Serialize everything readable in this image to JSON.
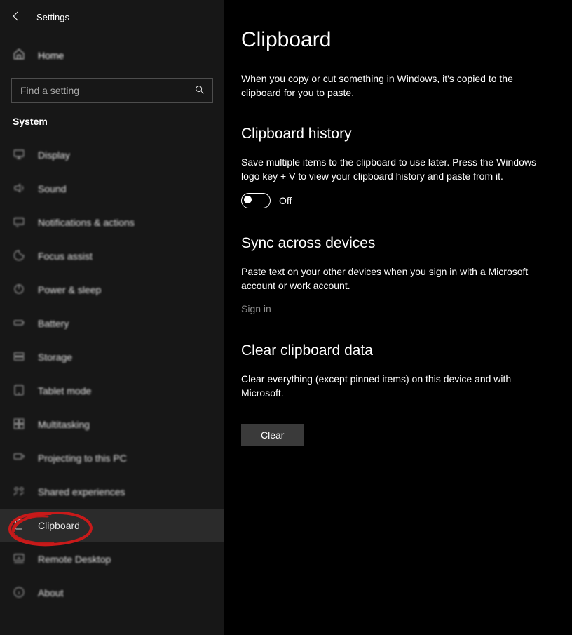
{
  "header": {
    "app": "Settings"
  },
  "sidebar": {
    "home": "Home",
    "search_placeholder": "Find a setting",
    "section": "System",
    "items": [
      {
        "label": "Display",
        "icon": "display-icon"
      },
      {
        "label": "Sound",
        "icon": "sound-icon"
      },
      {
        "label": "Notifications & actions",
        "icon": "notifications-icon"
      },
      {
        "label": "Focus assist",
        "icon": "focus-icon"
      },
      {
        "label": "Power & sleep",
        "icon": "power-icon"
      },
      {
        "label": "Battery",
        "icon": "battery-icon"
      },
      {
        "label": "Storage",
        "icon": "storage-icon"
      },
      {
        "label": "Tablet mode",
        "icon": "tablet-icon"
      },
      {
        "label": "Multitasking",
        "icon": "multitasking-icon"
      },
      {
        "label": "Projecting to this PC",
        "icon": "project-icon"
      },
      {
        "label": "Shared experiences",
        "icon": "shared-icon"
      },
      {
        "label": "Clipboard",
        "icon": "clipboard-icon",
        "active": true
      },
      {
        "label": "Remote Desktop",
        "icon": "remote-icon"
      },
      {
        "label": "About",
        "icon": "about-icon"
      }
    ]
  },
  "main": {
    "title": "Clipboard",
    "intro": "When you copy or cut something in Windows, it's copied to the clipboard for you to paste.",
    "history": {
      "heading": "Clipboard history",
      "desc": "Save multiple items to the clipboard to use later. Press the Windows logo key + V to view your clipboard history and paste from it.",
      "toggle_state": "Off"
    },
    "sync": {
      "heading": "Sync across devices",
      "desc": "Paste text on your other devices when you sign in with a Microsoft account or work account.",
      "link": "Sign in"
    },
    "clear": {
      "heading": "Clear clipboard data",
      "desc": "Clear everything (except pinned items) on this device and with Microsoft.",
      "button": "Clear"
    }
  }
}
